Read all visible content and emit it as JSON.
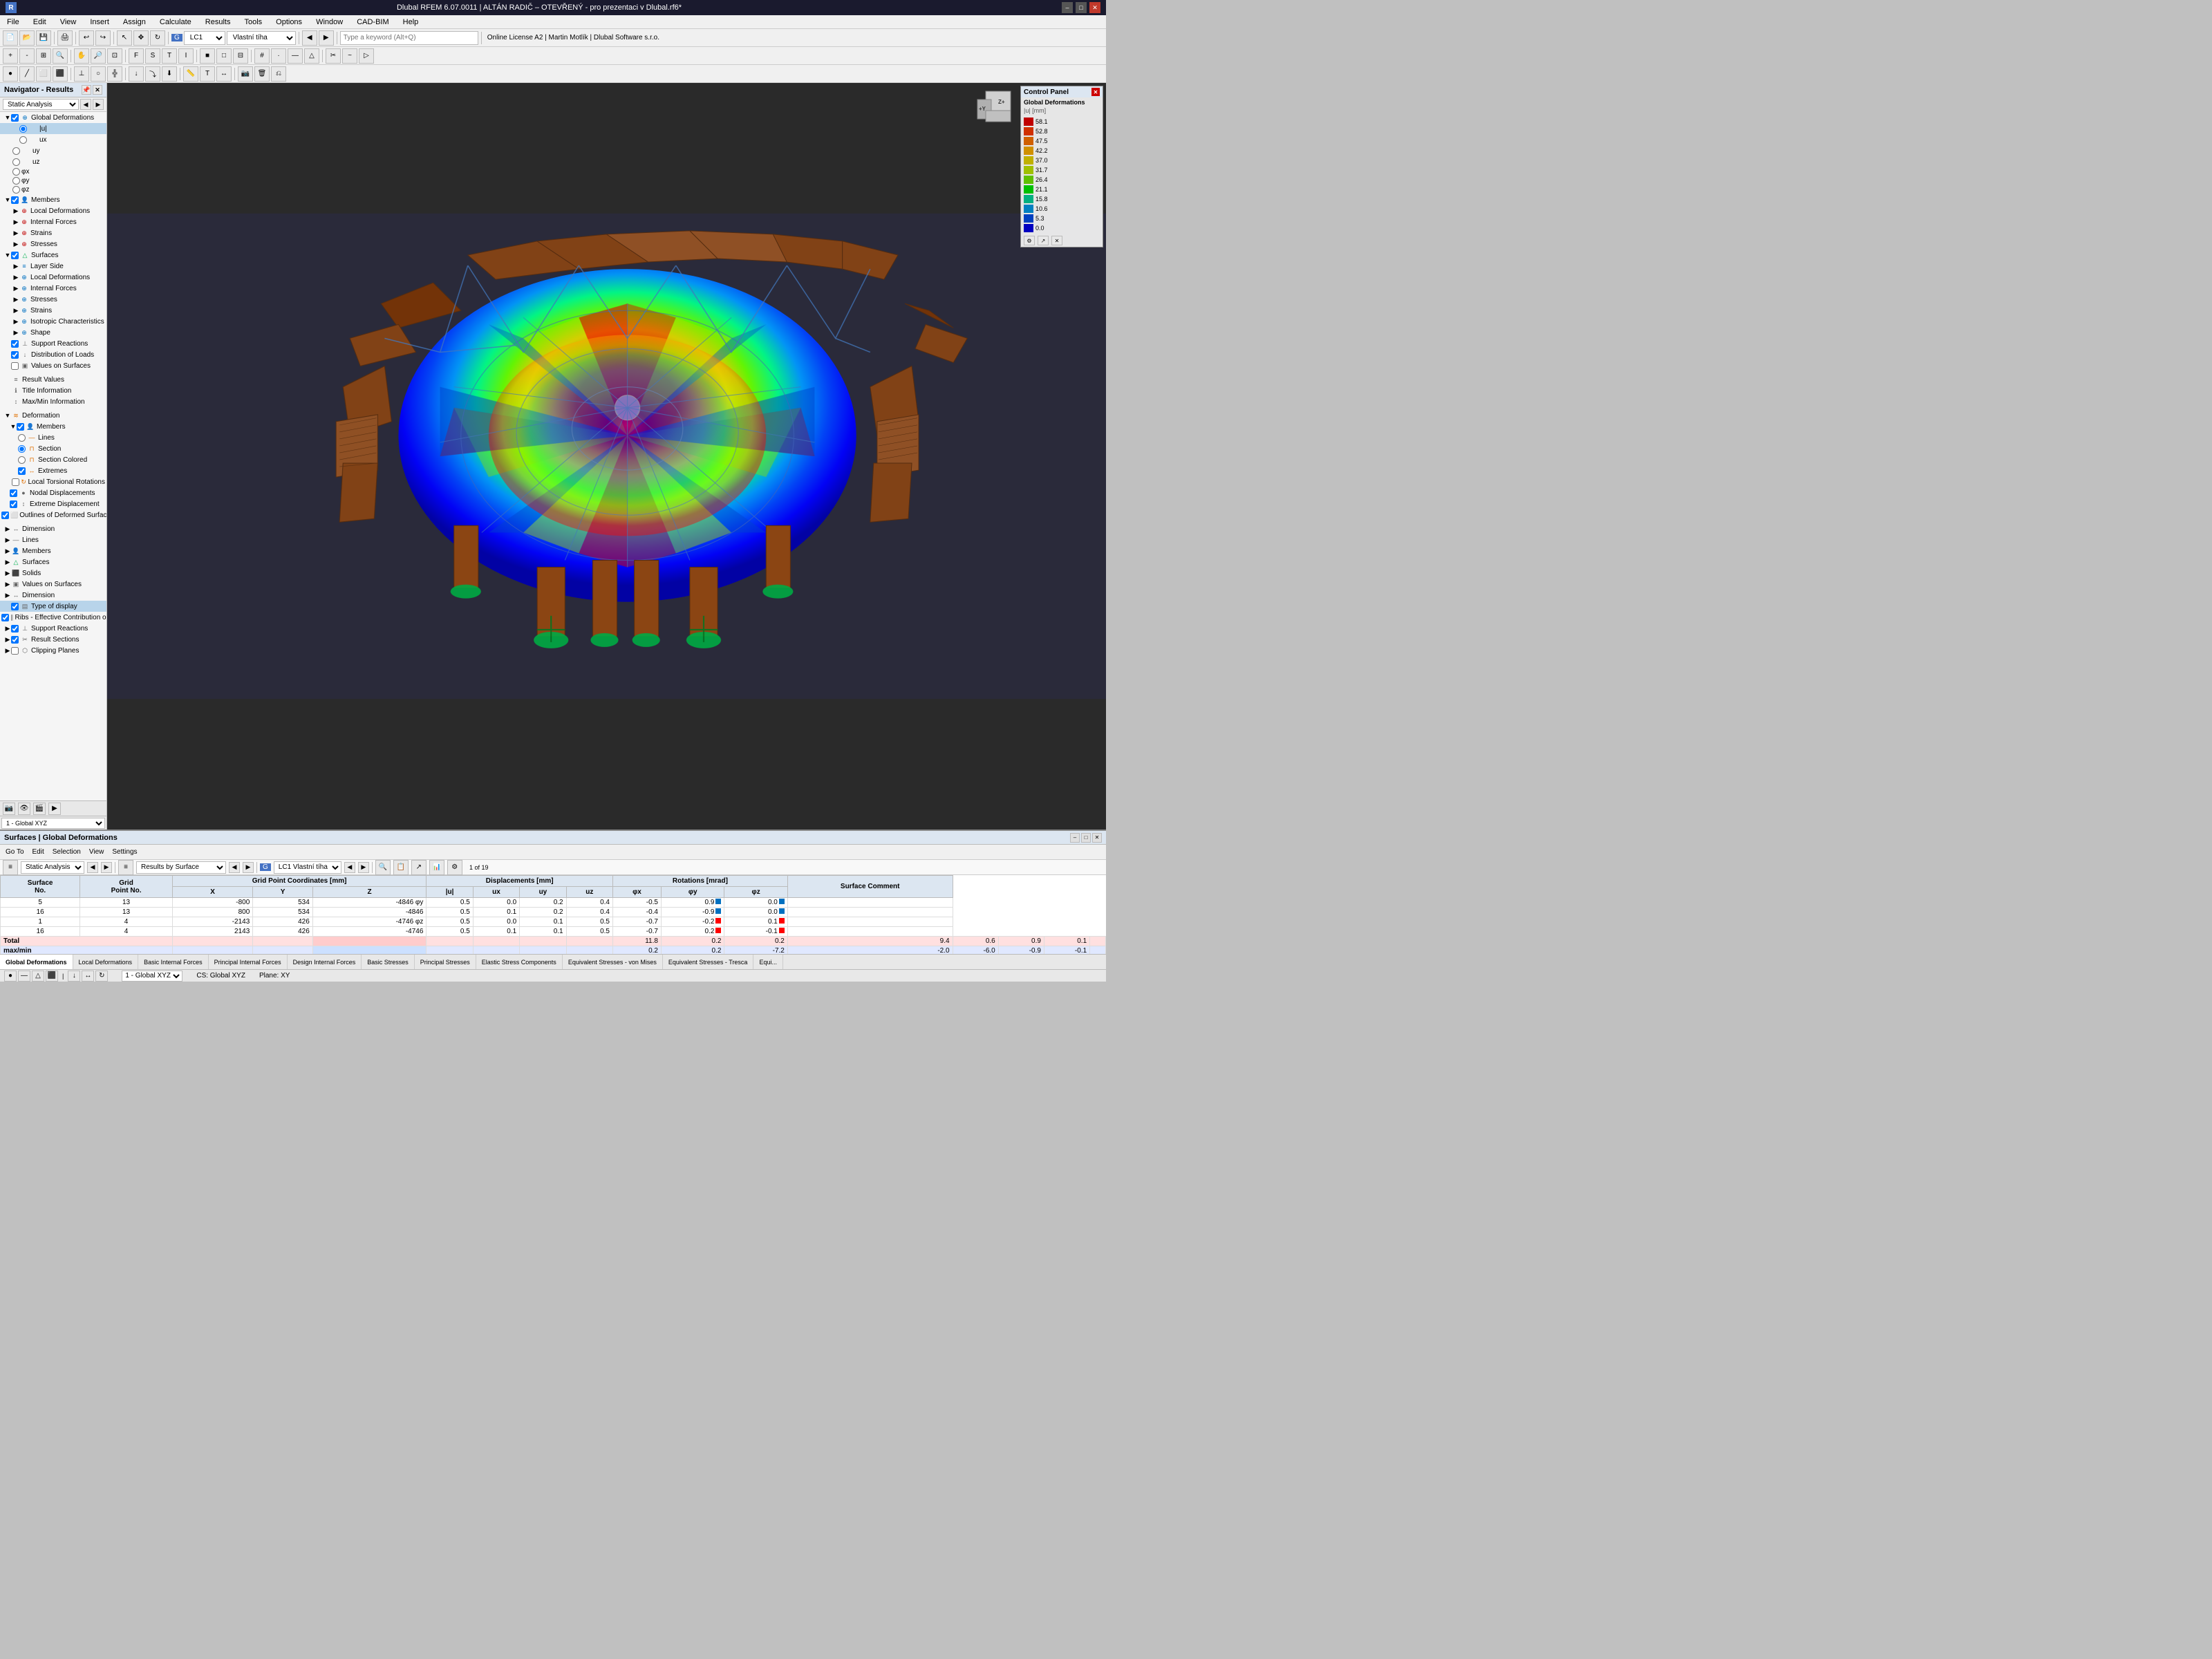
{
  "titleBar": {
    "title": "Dlubal RFEM 6.07.0011 | ALTÁN RADIČ – OTEVŘENÝ - pro prezentaci v Dlubal.rf6*",
    "windowControls": [
      "–",
      "□",
      "✕"
    ]
  },
  "menuBar": {
    "items": [
      "File",
      "Edit",
      "View",
      "Insert",
      "Assign",
      "Calculate",
      "Results",
      "Tools",
      "Options",
      "Window",
      "CAD-BIM",
      "Help"
    ]
  },
  "toolbar": {
    "loadCombo": "LC1",
    "loadName": "Vlastní tíha",
    "searchPlaceholder": "Type a keyword (Alt+Q)"
  },
  "navigator": {
    "title": "Navigator - Results",
    "filterLabel": "Static Analysis",
    "globalDeformations": {
      "label": "Global Deformations",
      "items": [
        "|u|",
        "ux",
        "uy",
        "uz",
        "φx",
        "φy",
        "φz"
      ]
    },
    "members": {
      "label": "Members",
      "items": [
        "Local Deformations",
        "Internal Forces",
        "Strains",
        "Stresses"
      ]
    },
    "surfaces": {
      "label": "Surfaces",
      "items": [
        "Layer Side",
        "Local Deformations",
        "Internal Forces",
        "Stresses",
        "Strains",
        "Isotropic Characteristics",
        "Shape"
      ]
    },
    "supportReactions": "Support Reactions",
    "distributionOfLoads": "Distribution of Loads",
    "valuesOnSurfaces": "Values on Surfaces",
    "resultValues": "Result Values",
    "titleInformation": "Title Information",
    "maxMinInformation": "Max/Min Information",
    "deformation": {
      "label": "Deformation",
      "members": {
        "label": "Members",
        "items": [
          "Lines",
          "Section",
          "Section Colored",
          "Extremes",
          "Local Torsional Rotations"
        ]
      },
      "nodalDisplacements": "Nodal Displacements",
      "extremeDisplacement": "Extreme Displacement",
      "outlinesOfDeformedSurfaces": "Outlines of Deformed Surfaces"
    },
    "dimension": "Dimension",
    "lines": "Lines",
    "membersLabel": "Members",
    "surfaces2": "Surfaces",
    "solids": "Solids",
    "valuesOnSurfaces2": "Values on Surfaces",
    "dimension2": "Dimension",
    "typeOfDisplay": "Type of display",
    "ribsLabel": "Ribs - Effective Contribution on Surface/Member",
    "supportReactions2": "Support Reactions",
    "resultSections": "Result Sections",
    "clippingPlanes": "Clipping Planes"
  },
  "controlPanel": {
    "title": "Control Panel",
    "subtitle": "Global Deformations",
    "unit": "|u| [mm]",
    "scaleValues": [
      "58.1",
      "52.8",
      "47.5",
      "42.2",
      "37.0",
      "31.7",
      "26.4",
      "21.1",
      "15.8",
      "10.6",
      "5.3",
      "0.0"
    ],
    "colors": [
      "#C00000",
      "#D03000",
      "#D06000",
      "#D09000",
      "#C0B000",
      "#A0C000",
      "#60C000",
      "#00C000",
      "#00B080",
      "#0080C0",
      "#0040C0",
      "#0000C0"
    ]
  },
  "resultsPanel": {
    "title": "Surfaces | Global Deformations",
    "filterOptions": [
      "Static Analysis"
    ],
    "resultsByOptions": [
      "Results by Surface"
    ],
    "loadCase": "LC1  Vlastní tíha",
    "toolbar": {
      "items": [
        "Go To",
        "Edit",
        "Selection",
        "View",
        "Settings"
      ]
    },
    "table": {
      "headers": [
        "Surface No.",
        "Grid Point No.",
        "X",
        "Y",
        "Z",
        "|u|",
        "ux",
        "uy",
        "uz",
        "φx",
        "φy",
        "φz",
        "Surface Comment"
      ],
      "headerGroups": [
        "Surface",
        "Grid",
        "Grid Point Coordinates [mm]",
        "",
        "",
        "Displacements [mm]",
        "",
        "",
        "",
        "Rotations [mrad]",
        "",
        "",
        ""
      ],
      "rows": [
        {
          "surface": "5",
          "grid": "13",
          "x": "-800",
          "y": "534",
          "z": "-4846",
          "note": "φy",
          "u": "0.5",
          "ux": "0.0",
          "uy": "0.2",
          "uz": "0.4",
          "phiX": "-0.5",
          "phiY": "0.9",
          "phiZ": "0.0",
          "marker": "blue"
        },
        {
          "surface": "16",
          "grid": "13",
          "x": "800",
          "y": "534",
          "z": "-4846",
          "note": "",
          "u": "0.5",
          "ux": "0.1",
          "uy": "0.2",
          "uz": "0.4",
          "phiX": "-0.4",
          "phiY": "-0.9",
          "phiZ": "0.0",
          "marker": "blue"
        },
        {
          "surface": "1",
          "grid": "4",
          "x": "-2143",
          "y": "426",
          "z": "-4746",
          "note": "φz",
          "u": "0.5",
          "ux": "0.0",
          "uy": "0.1",
          "uz": "0.5",
          "phiX": "-0.7",
          "phiY": "-0.2",
          "phiZ": "0.1",
          "marker": "red"
        },
        {
          "surface": "16",
          "grid": "4",
          "x": "2143",
          "y": "426",
          "z": "-4746",
          "note": "",
          "u": "0.5",
          "ux": "0.1",
          "uy": "0.1",
          "uz": "0.5",
          "phiX": "-0.7",
          "phiY": "0.2",
          "phiZ": "-0.1",
          "marker": "red"
        }
      ],
      "totals": {
        "label": "Total max/min",
        "uMax": "11.8",
        "uMin": "0.2",
        "uxMax": "0.2",
        "uxMin": "0.2",
        "uyMax": "0.2",
        "uyMin": "-7.2",
        "uzMax": "9.4",
        "uzMin": "-2.0",
        "phiXMax": "0.6",
        "phiXMin": "-6.0",
        "phiYMax": "0.9",
        "phiYMin": "-0.9",
        "phiZMax": "0.1",
        "phiZMin": "-0.1"
      },
      "paginationInfo": "1 of 19"
    }
  },
  "tabBar": {
    "tabs": [
      "Global Deformations",
      "Local Deformations",
      "Basic Internal Forces",
      "Principal Internal Forces",
      "Design Internal Forces",
      "Basic Stresses",
      "Principal Stresses",
      "Elastic Stress Components",
      "Equivalent Stresses - von Mises",
      "Equivalent Stresses - Tresca",
      "Equi..."
    ]
  },
  "statusBar": {
    "left": [
      "1 - Global XYZ"
    ],
    "right": [
      "CS: Global XYZ",
      "Plane: XY"
    ]
  }
}
